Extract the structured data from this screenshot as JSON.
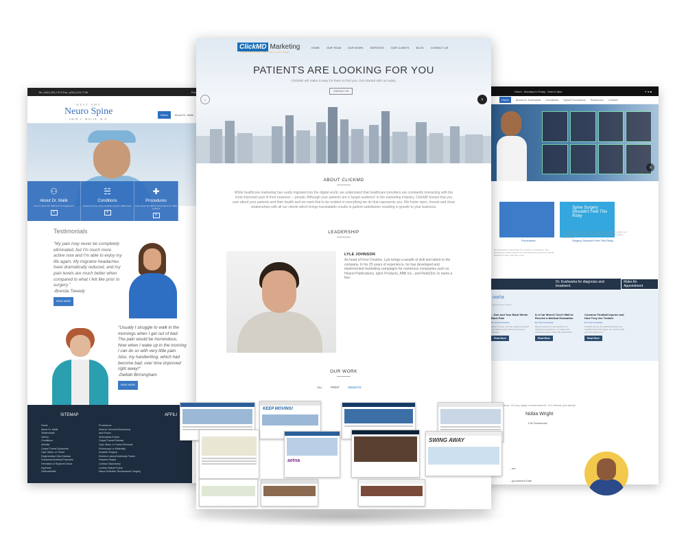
{
  "left": {
    "topbar_left": "Tel: (432) 203-7473   Fax: (432) 203-7749",
    "topbar_right": "Primary Office",
    "logo_small": "WEST AMC",
    "logo_big": "Neuro Spine",
    "logo_sub": "AMIR S. MALIK, M.D.",
    "nav": [
      "Home",
      "About Dr. Malik"
    ],
    "cards": [
      {
        "title": "About Dr. Malik",
        "desc": "Find out about Dr. Malik and his background",
        "icon": "doctor-icon"
      },
      {
        "title": "Conditions",
        "desc": "Read about the many conditions that Dr. Malik treats",
        "icon": "spine-icon"
      },
      {
        "title": "Procedures",
        "desc": "Learn about the different procedures Dr. Malik performs",
        "icon": "cross-icon"
      }
    ],
    "testimonials_title": "Testimonials",
    "quote1": "\"My pain may never be completely eliminated, but I'm much more active now and I'm able to enjoy my life again. My migraine headaches have dramatically reduced, and my pain levels are much better when compared to what I felt like prior to surgery.\"",
    "quote1_author": "-Brenda Tweedy",
    "quote2": "\"Usually I struggle to walk in the mornings when I get out of bed. The pain would be horrendous. Now when I wake up in the morning I can do so with very little pain. Also, my handwriting, which had become bad, over time improved right away!\"",
    "quote2_author": "-Delilah Birmingham",
    "read_more": "READ MORE",
    "sitemap_title": "SITEMAP",
    "affiliations_title": "AFFILI",
    "sitemap_col1": [
      "Home",
      "About Dr. Malik",
      "Testimonials",
      "Videos",
      "Conditions",
      "Arthritis",
      "Carpal Tunnel Syndrome",
      "Cyst, Mass, or Tumor",
      "Degenerative Disc Disease",
      "Fractures/Vertebral Fractures",
      "Herniated or Ruptured Discs",
      "Kyphosis",
      "Osteoarthritis"
    ],
    "sitemap_col2": [
      "Procedures",
      "Anterior Cervical Discectomy",
      "and Fusion",
      "Arthrodesis Fusion",
      "Carpal Tunnel Release",
      "Cyst, Mass, or Tumor Removal",
      "Endoscopic or Minimally",
      "Invasive Surgery",
      "Extreme Lateral Interbody Fusion",
      "Fracture Repair",
      "Lumbar Discectomy",
      "Lumbar Spinal Fusion",
      "Mazor Robotics' Renaissance Surgery"
    ]
  },
  "center": {
    "logo_box": "ClickMD",
    "logo_text": "Marketing",
    "tagline": "YOUR PATIENTS ARE ONE CLICK AWAY",
    "nav": [
      "HOME",
      "OUR TEAM",
      "OUR WORK",
      "SERVICES",
      "OUR CLIENTS",
      "BLOG",
      "CONTACT US"
    ],
    "hero_title": "PATIENTS ARE LOOKING FOR YOU",
    "hero_lead": "ClickMD will make it easy for them to find you. Get started with us today.",
    "hero_button": "CONTACT US",
    "about_title": "ABOUT CLICKMD",
    "about_text": "While healthcare marketing has vastly migrated into the digital world, we understand that healthcare providers are constantly interacting with the most important part of their business -- people. Although your patients are a 'target audience' in the marketing industry, ClickMD knows that you care about your patients and their health and we want that to be evident in everything we do that represents you. We foster open, honest and close relationships with all our clients which brings translatable results in patient satisfaction resulting in growth to your business.",
    "leadership_title": "LEADERSHIP",
    "leader_name": "LYLE JOHNSON",
    "leader_bio": "As head of First Creative, Lyle brings a wealth of skill and talent to the company. In his 25 years of experience, he has developed and implemented marketing campaigns for numerous companies such as Hearst Publications, Igloo Products, ABB Inc., and RediClinc to name a few.",
    "work_title": "OUR WORK",
    "work_tabs": [
      "ALL",
      "PRINT",
      "WEBSITE"
    ],
    "work_thumb_texts": [
      "KEEP MOVING!",
      "aetna",
      "SWING AWAY"
    ]
  },
  "right": {
    "topbar": "Hours : Monday to Friday : 9am to 5pm",
    "nav": [
      "Home",
      "About Dr. Kushwaha",
      "Conditions",
      "Spinal Procedures",
      "Resources",
      "Contact"
    ],
    "tile2_text": "Spine Surgery Shouldn't Feel This Risky",
    "cap1": "Procedures",
    "cap2": "Surgery Shouldn't Feel This Risky",
    "para1": "Dr. Kushwaha is well-known for a variety of procedures. The procedures include Anterior Cervical Discectomy, Extreme Lateral Interbody Fusion and many more.",
    "para2": "Not much feels riskier than surgery. That's why he patiently guides you when you need spine surgery; you need Dr. Kushwaha's the latest commercial.",
    "band_text": "Dr. Kushwaha for diagnosis and treatment.",
    "band_button": "Make An Appointment",
    "blog_name": "waha",
    "blog_sub": "Expert spine surgery",
    "posts": [
      {
        "title": "…ther and Your Back Winter Back Pain",
        "meta": "By Vivek Kushwaha",
        "text": "Winter is here, and that means increased potential for back injuries and injuries. Whether"
      },
      {
        "title": "In a Car Wreck? Don't Wait to Receive a Medical Evaluation",
        "meta": "By Vivek Kushwaha",
        "text": "Being involved in a car accident is a frightening experience, no matter how serious the wreck. Once the initial shock"
      },
      {
        "title": "Common Football Injuries and How They Are Treated",
        "meta": "By Vivek Kushwaha",
        "text": "Football may be the national pastime, but football is America's game. So much so that you don't have to be."
      }
    ],
    "read_more": "Read More",
    "testimonial_text": "…ness. I'd very highly recommend Dr. K to friends and family!",
    "testimonial_name": "Nobia Wright",
    "testimonial_sub": "Full Testimonial",
    "footer_text1": "…me",
    "footer_text2": "…ppointment Date"
  }
}
